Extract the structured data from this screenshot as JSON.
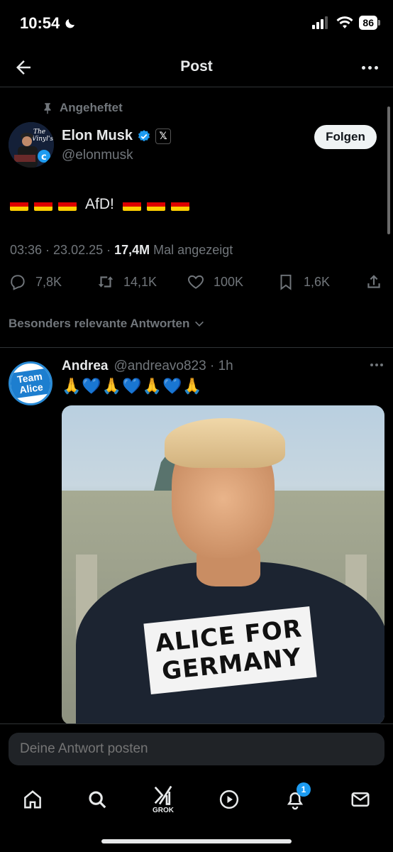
{
  "status_bar": {
    "time": "10:54",
    "battery": "86"
  },
  "header": {
    "title": "Post"
  },
  "post": {
    "pinned_label": "Angeheftet",
    "author_name": "Elon Musk",
    "author_handle": "@elonmusk",
    "follow_label": "Folgen",
    "text": "AfD!",
    "time": "03:36",
    "date": "23.02.25",
    "views": "17,4M",
    "views_label": "Mal angezeigt",
    "replies": "7,8K",
    "reposts": "14,1K",
    "likes": "100K",
    "bookmarks": "1,6K"
  },
  "replies_filter": "Besonders relevante Antworten",
  "reply": {
    "avatar_text": "Team Alice",
    "name": "Andrea",
    "handle": "@andreavo823",
    "age": "1h",
    "text": "🙏💙🙏💙🙏💙🙏",
    "image_shirt_line1": "ALICE FOR",
    "image_shirt_line2": "GERMANY"
  },
  "reply_box": {
    "placeholder": "Deine Antwort posten"
  },
  "bottom_nav": {
    "grok_label": "GROK",
    "notifications_count": "1"
  },
  "colors": {
    "accent": "#1d9bf0",
    "text": "#e7e9ea",
    "muted": "#71767b",
    "background": "#000000"
  }
}
